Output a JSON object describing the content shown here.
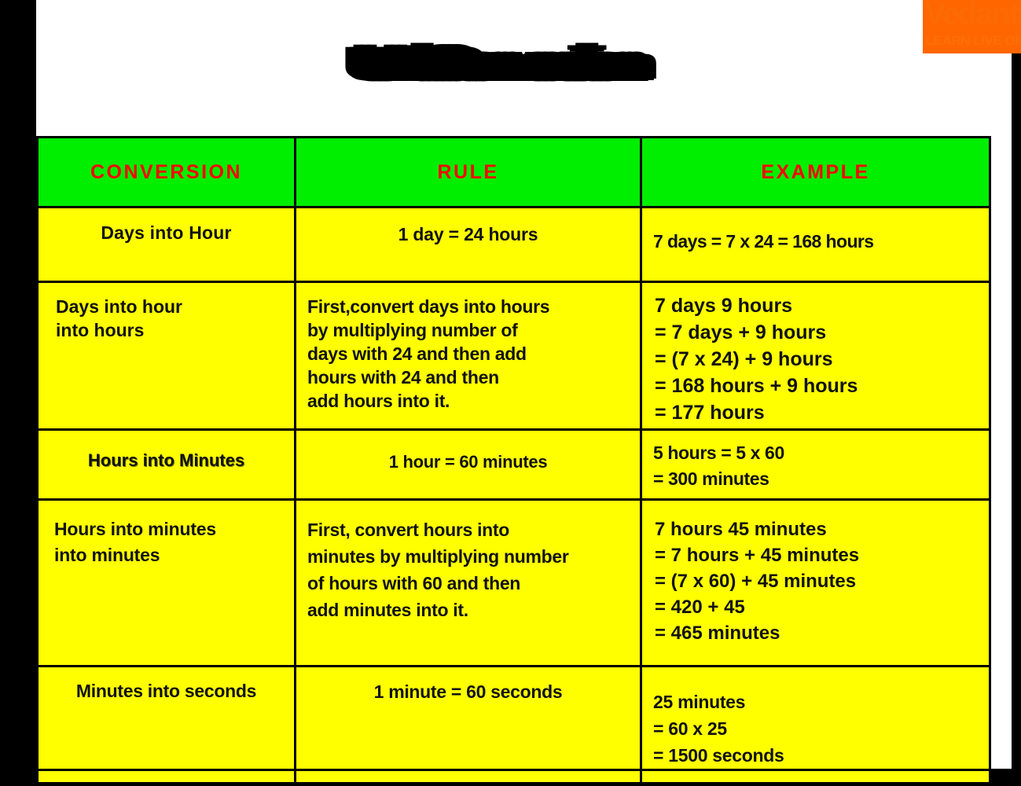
{
  "slide": {
    "title": "Unit Conversion",
    "background_color": "#000000",
    "board_color": "#FFFFFF"
  },
  "logo": {
    "name": "logo-watermark",
    "text": "Vedantu",
    "subtext": "LEARN LIVE ONLINE",
    "block_color": "#FF6600",
    "text_color": "#FB6A05"
  },
  "table": {
    "header_bg": "#00EE00",
    "header_color": "#FF0000",
    "row_bg": "#FFFF00",
    "border_color": "#000000",
    "headers": [
      "CONVERSION",
      "RULE",
      "EXAMPLE"
    ],
    "rows": [
      {
        "conversion": "Days into Hour",
        "rule": "1 day = 24 hours",
        "example": "7 days = 7 x 24 = 168 hours"
      },
      {
        "conversion": "Days into hour\ninto hours",
        "rule": "First,convert days into hours\nby multiplying number of\ndays with 24 and then add\nhours with 24 and then\nadd hours into it.",
        "example": "7 days 9 hours\n= 7 days + 9 hours\n= (7 x 24) + 9 hours\n= 168 hours + 9 hours\n= 177 hours"
      },
      {
        "conversion": "Hours into Minutes",
        "rule": "1 hour = 60 minutes",
        "example": "5 hours = 5 x 60\n= 300 minutes"
      },
      {
        "conversion": "Hours into minutes\ninto minutes",
        "rule": "First, convert hours into\nminutes by multiplying number\nof hours with 60 and then\nadd minutes into it.",
        "example": "7 hours 45 minutes\n= 7 hours + 45 minutes\n= (7 x 60) + 45 minutes\n= 420 + 45\n= 465 minutes"
      },
      {
        "conversion": "Minutes into seconds",
        "rule": "1 minute = 60 seconds",
        "example": "25 minutes\n= 60 x 25\n= 1500 seconds"
      },
      {
        "conversion": "",
        "rule": "",
        "example": ""
      }
    ]
  }
}
